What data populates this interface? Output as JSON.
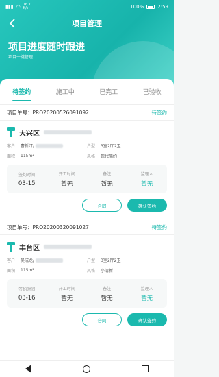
{
  "status_bar": {
    "battery": "100%",
    "time": "2:59",
    "speed": "16.7\nK/s"
  },
  "nav": {
    "title": "项目管理"
  },
  "hero": {
    "title": "项目进度随时跟进",
    "subtitle": "项目一键管理"
  },
  "tabs": [
    {
      "label": "待签约",
      "active": true
    },
    {
      "label": "施工中",
      "active": false
    },
    {
      "label": "已完工",
      "active": false
    },
    {
      "label": "已验收",
      "active": false
    }
  ],
  "labels": {
    "order_prefix": "项目单号：",
    "customer": "客户：",
    "area": "面积：",
    "layout": "户型：",
    "style": "风格：",
    "sign_time": "签约时间",
    "start_time": "开工时间",
    "remark": "备注",
    "supervisor": "监理人",
    "contract_btn": "合同",
    "confirm_btn": "确认签约"
  },
  "cards": [
    {
      "order_no": "PRO20200526091092",
      "status": "待签约",
      "district": "大兴区",
      "customer": "曹新汀/",
      "area": "115m²",
      "layout": "3室2厅2卫",
      "style": "现代简约",
      "sign_time": "03-15",
      "start_time": "暂无",
      "remark": "暂无",
      "supervisor": "暂无"
    },
    {
      "order_no": "PRO20200320091027",
      "status": "待签约",
      "district": "丰台区",
      "customer": "吴成龙/",
      "area": "115m²",
      "layout": "3室2厅2卫",
      "style": "小清新",
      "sign_time": "03-16",
      "start_time": "暂无",
      "remark": "暂无",
      "supervisor": "暂无"
    }
  ],
  "colors": {
    "accent": "#1bb9ae"
  }
}
